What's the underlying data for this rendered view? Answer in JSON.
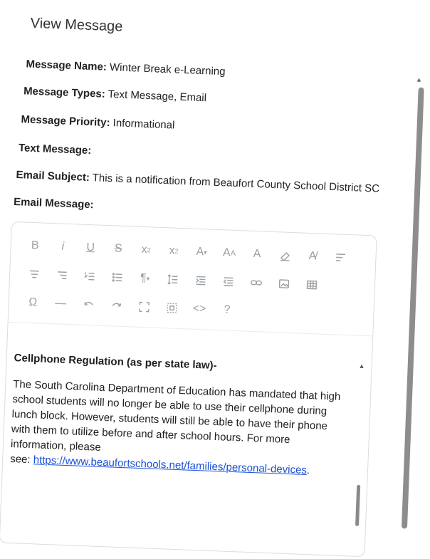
{
  "dialog": {
    "title": "View Message"
  },
  "fields": {
    "message_name": {
      "label": "Message Name:",
      "value": "Winter Break e-Learning"
    },
    "message_types": {
      "label": "Message Types:",
      "value": "Text Message, Email"
    },
    "message_priority": {
      "label": "Message Priority:",
      "value": "Informational"
    },
    "text_message": {
      "label": "Text Message:",
      "value": ""
    },
    "email_subject": {
      "label": "Email Subject:",
      "value": "This is a notification from Beaufort County School District SC"
    },
    "email_message": {
      "label": "Email Message:"
    }
  },
  "toolbar": {
    "row1": [
      "bold-icon",
      "italic-icon",
      "underline-icon",
      "strikethrough-icon",
      "subscript-icon",
      "superscript-icon",
      "font-color-icon",
      "font-size-icon",
      "highlight-icon",
      "eraser-icon",
      "clear-format-icon",
      "align-left-icon"
    ],
    "row2": [
      "align-center-icon",
      "align-right-icon",
      "ordered-list-icon",
      "unordered-list-icon",
      "paragraph-icon",
      "line-height-icon",
      "indent-icon",
      "outdent-icon",
      "link-icon",
      "image-icon",
      "table-icon"
    ],
    "row3": [
      "special-char-icon",
      "horizontal-rule-icon",
      "undo-icon",
      "redo-icon",
      "fullscreen-icon",
      "select-all-icon",
      "code-view-icon",
      "help-icon"
    ]
  },
  "email_body": {
    "heading": "Cellphone Regulation (as per state law)-",
    "paragraph": "The South Carolina Department of Education has mandated that high school students will no longer be able to use their cellphone during lunch block. However, students will still be able to have their phone with them to utilize before and after school hours. For more information, please",
    "see_prefix": "see: ",
    "link": "https://www.beaufortschools.net/families/personal-devices",
    "suffix": "."
  }
}
